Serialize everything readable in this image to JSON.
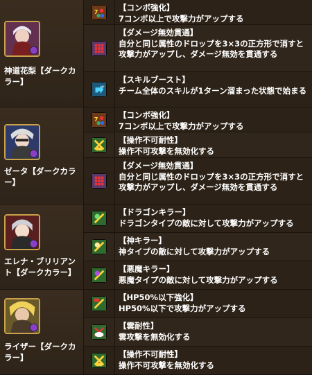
{
  "characters": [
    {
      "name": "神道花梨【ダークカラー】",
      "awakenings": [
        {
          "icon": "combo-enhance-icon",
          "title": "【コンボ強化】",
          "desc": "7コンボ以上で攻撃力がアップする"
        },
        {
          "icon": "damage-void-pierce-icon",
          "title": "【ダメージ無効貫通】",
          "desc": "自分と同じ属性のドロップを3×3の正方形で消すと攻撃力がアップし、ダメージ無効を貫通する"
        },
        {
          "icon": "skill-boost-icon",
          "title": "【スキルブースト】",
          "desc": "チーム全体のスキルが1ターン溜まった状態で始まる"
        }
      ]
    },
    {
      "name": "ゼータ【ダークカラー】",
      "awakenings": [
        {
          "icon": "combo-enhance-icon",
          "title": "【コンボ強化】",
          "desc": "7コンボ以上で攻撃力がアップする"
        },
        {
          "icon": "unable-to-operate-resist-icon",
          "title": "【操作不可耐性】",
          "desc": "操作不可攻撃を無効化する"
        },
        {
          "icon": "damage-void-pierce-icon",
          "title": "【ダメージ無効貫通】",
          "desc": "自分と同じ属性のドロップを3×3の正方形で消すと攻撃力がアップし、ダメージ無効を貫通する"
        }
      ]
    },
    {
      "name": "エレナ・ブリリアント【ダークカラー】",
      "awakenings": [
        {
          "icon": "dragon-killer-icon",
          "title": "【ドラゴンキラー】",
          "desc": "ドラゴンタイプの敵に対して攻撃力がアップする"
        },
        {
          "icon": "god-killer-icon",
          "title": "【神キラー】",
          "desc": "神タイプの敵に対して攻撃力がアップする"
        },
        {
          "icon": "devil-killer-icon",
          "title": "【悪魔キラー】",
          "desc": "悪魔タイプの敵に対して攻撃力がアップする"
        }
      ]
    },
    {
      "name": "ライザー【ダークカラー】",
      "awakenings": [
        {
          "icon": "hp50-below-enhance-icon",
          "title": "【HP50%以下強化】",
          "desc": "HP50%以下で攻撃力がアップする"
        },
        {
          "icon": "cloud-resist-icon",
          "title": "【雲耐性】",
          "desc": "雲攻撃を無効化する"
        },
        {
          "icon": "unable-to-operate-resist-icon",
          "title": "【操作不可耐性】",
          "desc": "操作不可攻撃を無効化する"
        }
      ]
    }
  ],
  "colors": {
    "frame": "#caa24a",
    "row_bg": "#2c2217",
    "row_bg_alt": "#31261b",
    "char_bg": "#3a2d20",
    "text": "#ffffff"
  }
}
